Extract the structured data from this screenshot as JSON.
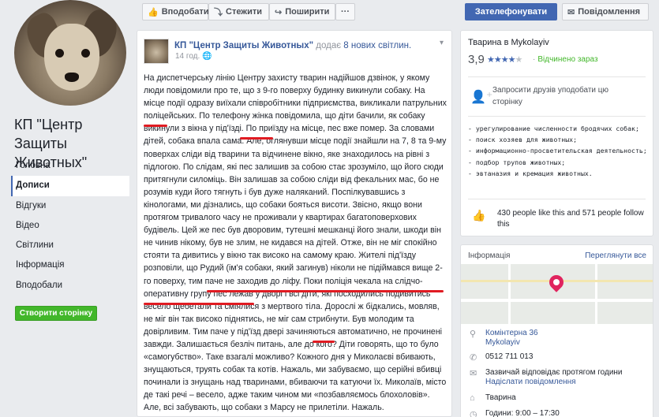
{
  "left": {
    "page_name": "КП \"Центр Защиты Животных\"",
    "nav": [
      "Головна",
      "Дописи",
      "Відгуки",
      "Відео",
      "Світлини",
      "Інформація",
      "Вподобали"
    ],
    "create_button": "Створити сторінку"
  },
  "topbar": {
    "like": "Вподобати",
    "follow": "Стежити",
    "share": "Поширити",
    "more": "···",
    "call": "Зателефонувати",
    "message": "Повідомлення"
  },
  "post": {
    "author": "КП \"Центр Защиты Животных\"",
    "added": "додає",
    "new_photos": "8 нових світлин.",
    "time": "14 год.",
    "text": "На диспетчерську лінію Центру захисту тварин надійшов дзвінок, у якому люди повідомили про те, що з 9-го поверху будинку викинули собаку. На місце події одразу виїхали співробітники підприємства, викликали патрульних поліцейських. По телефону жінка повідомила, що діти бачили, як собаку викинули з вікна у під'їзді. По приїзду на місце, пес вже помер. За словами дітей, собака впала сама. Але, оглянувши місце події знайшли на 7, 8 та 9-му поверхах сліди від тварини та відчинене вікно, яке знаходилось на рівні з підлогою. По слідам, які пес залишив за собою стає зрозуміло, що його сюди притягнули силоміць. Він залишав за собою сліди від фекальних мас, бо не розумів куди його тягнуть і був дуже наляканий. Поспілкувавшись з кінологами, ми дізнались, що собаки бояться висоти. Звісно, якщо вони протягом тривалого часу не проживали у квартирах багатоповерхових будівель. Цей же пес був дворовим, тутешні мешканці його знали, шкоди він не чинив нікому, був не злим, не кидався на дітей. Отже, він не міг спокійно стояти та дивитись у вікно так високо на самому краю. Жителі під'їзду розповіли, що Рудий (ім'я собаки, який загинув) ніколи не підіймався вище 2-го поверху, тим паче не заходив до ліфу. Поки поліція чекала на слідчо-оперативну групу пес лежав у дворі і всі діти, які посходились подивитись весело щебетали та сміялися з мертвого тіла. Дорослі ж бідкались, мовляв, не міг він так високо піднятись, не міг сам стрибнути. Був молодим та довірливим. Тим паче у під'їзд двері зачиняються автоматично, не прочинені завжди. Залишається безліч питань, але до кого? Діти говорять, що то було «самогубство». Таке взагалі можливо? Кожного дня у Миколаєві вбивають, знущаються, труять собак та котів. Нажаль, ми забуваємо, що серійні вбивці починали із знущань над тваринами, вбиваючи та катуючи їх. Миколаїв, місто де такі речі – весело, адже таким чином ми «позбавляємось блохоловів». Але, всі забувають, що собаки з Марсу не прилетіли. Нажаль."
  },
  "about": {
    "title": "Тварина в Mykolayiv",
    "rating": "3,9",
    "stars": 4,
    "open_status": "Відчинено зараз",
    "invite": "Запросити друзів уподобати цю сторінку",
    "description": [
      "- урегулирование численности бродячих собак;",
      "- поиск хозяев для животных;",
      "- информационно-просветительская деятельность;",
      "- подбор трупов животных;",
      "- эвтаназия и кремация животных."
    ],
    "likes": "430 people like this and 571 people follow this"
  },
  "info": {
    "title": "Інформація",
    "edit": "Переглянути все",
    "address_line1": "Комінтерна 36",
    "address_line2": "Mykolayiv",
    "phone": "0512 711 013",
    "response_line1": "Зазвичай відповідає протягом години",
    "response_line2": "Надіслати повідомлення",
    "category": "Тварина",
    "hours": "Години: 9:00 – 17:30"
  },
  "colors": {
    "accent": "#4267b2",
    "link": "#365899",
    "green": "#42b72a",
    "highlight": "#e01b22"
  }
}
